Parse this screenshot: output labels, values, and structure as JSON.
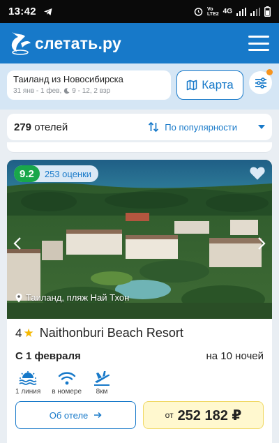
{
  "status_bar": {
    "time": "13:42",
    "network": "4G"
  },
  "header": {
    "logo_text": "слетать.ру"
  },
  "search": {
    "title": "Таиланд из Новосибирска",
    "dates": "31 янв - 1 фев,",
    "nights": "9 - 12, 2 взр",
    "map_label": "Карта"
  },
  "results": {
    "count": "279",
    "count_label": "отелей",
    "sort_label": "По популярности"
  },
  "hotel": {
    "rating": "9.2",
    "reviews": "253 оценки",
    "location": "Таиланд, пляж Най Тхон",
    "stars": "4",
    "name": "Naithonburi Beach Resort",
    "date": "С 1 февраля",
    "nights": "на 10 ночей",
    "amenities": [
      {
        "icon": "beach-icon",
        "label": "1 линия"
      },
      {
        "icon": "wifi-icon",
        "label": "в номере"
      },
      {
        "icon": "airport-icon",
        "label": "8км"
      }
    ],
    "about_label": "Об отеле",
    "price_from": "от",
    "price": "252 182 ₽"
  },
  "colors": {
    "brand": "#1779c9",
    "rating_green": "#19a74a",
    "star": "#f5b800",
    "price_bg": "#fff8cf",
    "badge_orange": "#f7941d"
  }
}
